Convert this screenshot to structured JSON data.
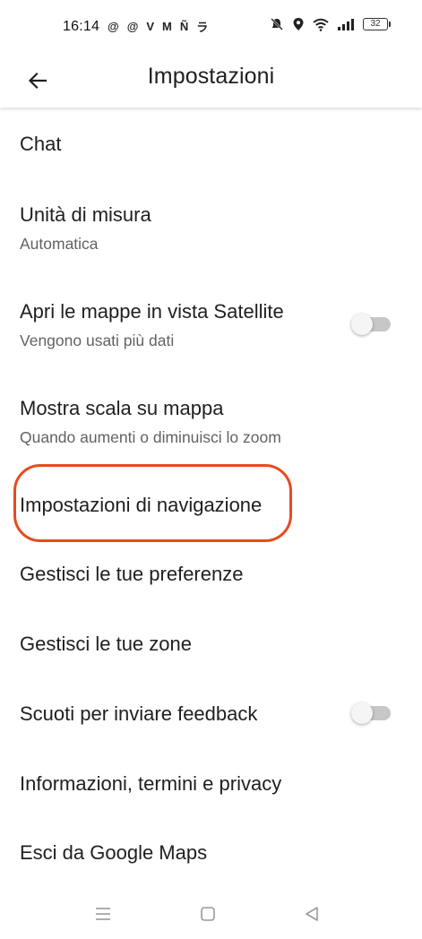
{
  "status_bar": {
    "time": "16:14",
    "app_icons": [
      "@",
      "@",
      "V",
      "M",
      "Ñ",
      "ラ"
    ],
    "battery": "32"
  },
  "header": {
    "title": "Impostazioni",
    "back_icon": "arrow-back-icon"
  },
  "settings": [
    {
      "title": "Chat",
      "subtitle": null,
      "toggle": null
    },
    {
      "title": "Unità di misura",
      "subtitle": "Automatica",
      "toggle": null
    },
    {
      "title": "Apri le mappe in vista Satellite",
      "subtitle": "Vengono usati più dati",
      "toggle": false
    },
    {
      "title": "Mostra scala su mappa",
      "subtitle": "Quando aumenti o diminuisci lo zoom",
      "toggle": null
    },
    {
      "title": "Impostazioni di navigazione",
      "subtitle": null,
      "toggle": null,
      "highlighted": true
    },
    {
      "title": "Gestisci le tue preferenze",
      "subtitle": null,
      "toggle": null
    },
    {
      "title": "Gestisci le tue zone",
      "subtitle": null,
      "toggle": null
    },
    {
      "title": "Scuoti per inviare feedback",
      "subtitle": null,
      "toggle": false
    },
    {
      "title": "Informazioni, termini e privacy",
      "subtitle": null,
      "toggle": null
    },
    {
      "title": "Esci da Google Maps",
      "subtitle": null,
      "toggle": null
    }
  ],
  "colors": {
    "highlight": "#e84a1f",
    "text_primary": "#1f1f1f",
    "text_secondary": "#5f6368",
    "toggle_track_off": "#c7c7c7"
  },
  "nav_bar": {
    "icons": [
      "menu-icon",
      "home-square-icon",
      "back-triangle-icon"
    ]
  }
}
